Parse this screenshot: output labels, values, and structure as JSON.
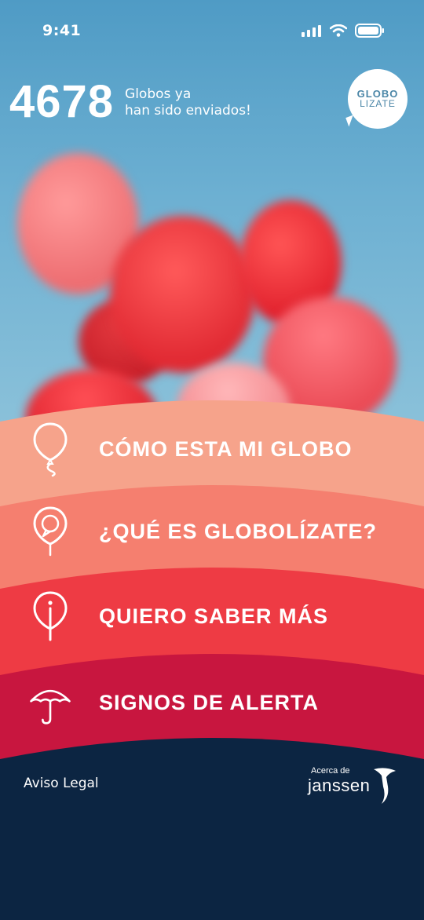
{
  "status_bar": {
    "time": "9:41",
    "icons": [
      "signal-icon",
      "wifi-icon",
      "battery-icon"
    ]
  },
  "header": {
    "counter": "4678",
    "counter_text_line1": "Globos ya",
    "counter_text_line2": "han sido enviados!",
    "logo_line1": "GLOBO",
    "logo_line2": "LIZATE"
  },
  "menu": {
    "items": [
      {
        "label": "CÓMO ESTA MI GLOBO",
        "icon": "balloon-icon",
        "color": "#f6a38b"
      },
      {
        "label": "¿QUÉ ES GLOBOLÍZATE?",
        "icon": "balloon-speech-icon",
        "color": "#f57f6f"
      },
      {
        "label": "QUIERO SABER MÁS",
        "icon": "info-balloon-icon",
        "color": "#ee3b44"
      },
      {
        "label": "SIGNOS DE ALERTA",
        "icon": "umbrella-icon",
        "color": "#c8163f"
      }
    ]
  },
  "footer": {
    "legal_link": "Aviso Legal",
    "janssen_caption": "Acerca de",
    "janssen_name": "janssen",
    "background": "#0c2542"
  }
}
